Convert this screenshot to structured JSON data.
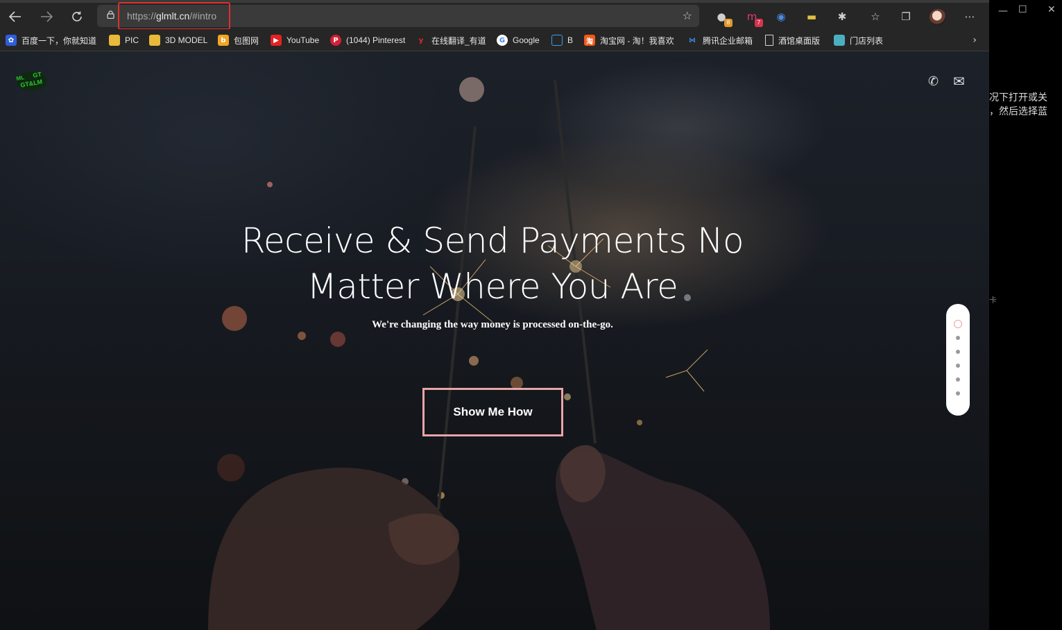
{
  "browser": {
    "url_protocol": "https://",
    "url_host": "glmlt.cn",
    "url_fragment": "/#intro",
    "extension_badges": {
      "ext1": "8",
      "ext2": "7"
    },
    "bookmarks": [
      {
        "label": "百度一下，你就知道",
        "icon": "baidu-icon"
      },
      {
        "label": "PIC",
        "icon": "folder-icon"
      },
      {
        "label": "3D MODEL",
        "icon": "folder-icon"
      },
      {
        "label": "包图网",
        "icon": "baotu-icon"
      },
      {
        "label": "YouTube",
        "icon": "youtube-icon"
      },
      {
        "label": "(1044) Pinterest",
        "icon": "pinterest-icon"
      },
      {
        "label": "在线翻译_有道",
        "icon": "youdao-icon"
      },
      {
        "label": "Google",
        "icon": "google-icon"
      },
      {
        "label": "B",
        "icon": "bilibili-icon"
      },
      {
        "label": "淘宝网 - 淘！我喜欢",
        "icon": "taobao-icon"
      },
      {
        "label": "腾讯企业邮箱",
        "icon": "tencent-mail-icon"
      },
      {
        "label": "酒馆桌面版",
        "icon": "page-icon"
      },
      {
        "label": "门店列表",
        "icon": "store-icon"
      }
    ]
  },
  "hero": {
    "headline_line1": "Receive & Send Payments No",
    "headline_line2": "Matter Where You Are",
    "subline": "We're changing the way money is processed on-the-go.",
    "cta_label": "Show Me How",
    "logo_text_top": "GT",
    "logo_text_bottom": "GT&LM",
    "logo_text_side": "ML"
  },
  "dot_nav": {
    "count": 6,
    "active_index": 0
  },
  "right_window": {
    "line1": "况下打开或关",
    "line2": "，然后选择蓝",
    "line3": "卡"
  },
  "colors": {
    "accent": "#e8a5a7",
    "highlight": "#e0302b"
  }
}
